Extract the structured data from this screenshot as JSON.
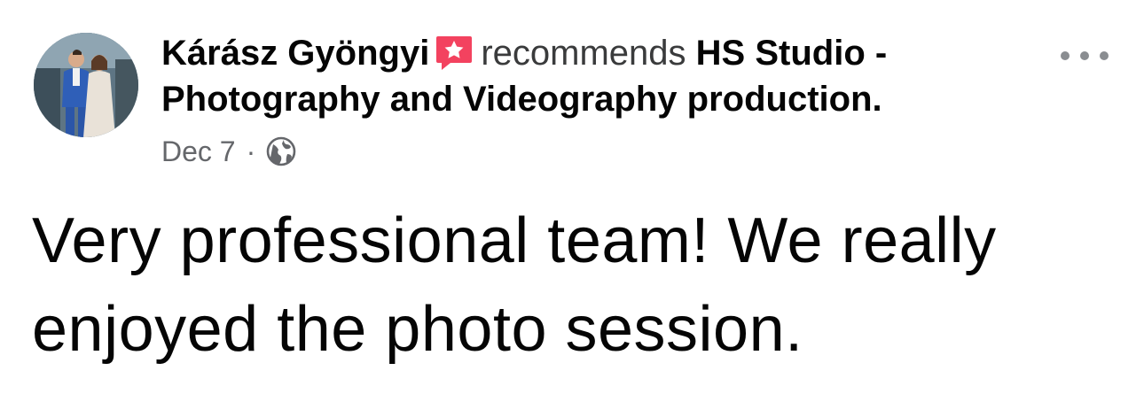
{
  "post": {
    "author": "Kárász Gyöngyi",
    "action": "recommends",
    "page_name": "HS Studio - Photography and Videography production.",
    "date": "Dec 7",
    "separator": "·",
    "privacy_icon": "globe-icon",
    "recommend_badge_icon": "star-badge-icon",
    "more_icon": "more-dots-icon",
    "text": "Very professional team! We really enjoyed the photo session."
  },
  "colors": {
    "badge": "#f3425f",
    "meta_text": "#65676b",
    "primary_text": "#050505"
  }
}
